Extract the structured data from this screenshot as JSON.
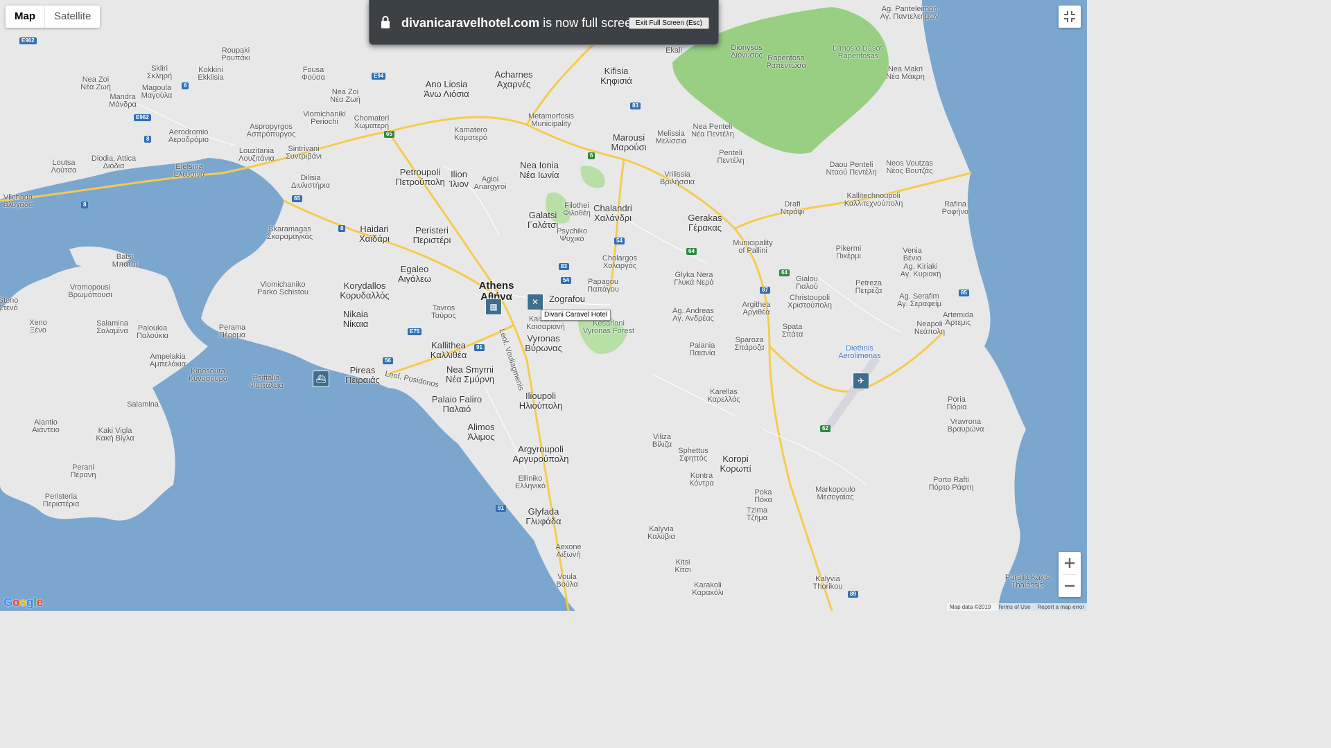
{
  "map_type": {
    "map_label": "Map",
    "satellite_label": "Satellite",
    "selected": "Map"
  },
  "fullscreen_banner": {
    "domain": "divanicaravelhotel.com",
    "message": " is now full screen",
    "exit_button": "Exit Full Screen (Esc)"
  },
  "tooltip": "Divani Caravel Hotel",
  "attribution": {
    "map_data": "Map data ©2019",
    "terms": "Terms of Use",
    "report": "Report a map error"
  },
  "logo": "Google",
  "colors": {
    "water": "#7ba7cf",
    "land": "#e8e8e8",
    "park": "#b7dfa6",
    "forest": "#98cf83",
    "highway": "#f4cb4d",
    "poi": "#3f6d8c"
  },
  "places": [
    {
      "id": "roupaki",
      "l1": "Roupaki",
      "l2": "Ρουπάκι",
      "cls": ""
    },
    {
      "id": "skliri",
      "l1": "Skliri",
      "l2": "Σκληρή",
      "cls": ""
    },
    {
      "id": "neazoi-w",
      "l1": "Nea Zoi",
      "l2": "Νέα Ζωή",
      "cls": ""
    },
    {
      "id": "magoula",
      "l1": "Magoula",
      "l2": "Μαγούλα",
      "cls": ""
    },
    {
      "id": "mandra",
      "l1": "Mandra",
      "l2": "Μάνδρα",
      "cls": ""
    },
    {
      "id": "kokkini",
      "l1": "Kokkini",
      "l2": "Ekklisia",
      "cls": ""
    },
    {
      "id": "fousa",
      "l1": "Fousa",
      "l2": "Φούσα",
      "cls": ""
    },
    {
      "id": "neazoi-e",
      "l1": "Nea Zoi",
      "l2": "Νέα Ζωή",
      "cls": ""
    },
    {
      "id": "viomichaniki",
      "l1": "Viomichaniki",
      "l2": "Periochi",
      "cls": ""
    },
    {
      "id": "chomateri",
      "l1": "Chomateri",
      "l2": "Χωματερή",
      "cls": ""
    },
    {
      "id": "aerodromio",
      "l1": "Aerodromio",
      "l2": "Αεροδρόμιο",
      "cls": ""
    },
    {
      "id": "aspropyrgos",
      "l1": "Aspropyrgos",
      "l2": "Ασπρόπυργος",
      "cls": ""
    },
    {
      "id": "sintrivani",
      "l1": "Sintrivani",
      "l2": "Συντριβάνι",
      "cls": ""
    },
    {
      "id": "loutsa",
      "l1": "Loutsa",
      "l2": "Λούτσα",
      "cls": ""
    },
    {
      "id": "diodia",
      "l1": "Diodia, Attica",
      "l2": "Διόδια",
      "cls": ""
    },
    {
      "id": "elefsina",
      "l1": "Elefsina",
      "l2": "Ελευσίνα",
      "cls": ""
    },
    {
      "id": "louzitania",
      "l1": "Louzitania",
      "l2": "Λουζιτάνια",
      "cls": ""
    },
    {
      "id": "dilisia",
      "l1": "Dilisia",
      "l2": "Διυλιστήρια",
      "cls": ""
    },
    {
      "id": "vlichada",
      "l1": "Vlichada",
      "l2": "Βλυχάδα",
      "cls": ""
    },
    {
      "id": "skaramagas",
      "l1": "Skaramagas",
      "l2": "Σκαραμαγκάς",
      "cls": ""
    },
    {
      "id": "haidari",
      "l1": "Haidari",
      "l2": "Χαϊδάρι",
      "cls": "big"
    },
    {
      "id": "acharnes",
      "l1": "Acharnes",
      "l2": "Αχαρνές",
      "cls": "big"
    },
    {
      "id": "anoliosia",
      "l1": "Ano Liosia",
      "l2": "Άνω Λιόσια",
      "cls": "big"
    },
    {
      "id": "kifisia",
      "l1": "Kifisia",
      "l2": "Κηφισιά",
      "cls": "big"
    },
    {
      "id": "kamatero",
      "l1": "Kamatero",
      "l2": "Καματερό",
      "cls": ""
    },
    {
      "id": "metamorfosis",
      "l1": "Metamorfosis",
      "l2": "Municipality",
      "cls": ""
    },
    {
      "id": "marousi",
      "l1": "Marousi",
      "l2": "Μαρούσι",
      "cls": "big"
    },
    {
      "id": "melissia",
      "l1": "Melissia",
      "l2": "Μελίσσια",
      "cls": ""
    },
    {
      "id": "neapenteli",
      "l1": "Nea Penteli",
      "l2": "Νέα Πεντέλη",
      "cls": ""
    },
    {
      "id": "penteli",
      "l1": "Penteli",
      "l2": "Πεντέλη",
      "cls": ""
    },
    {
      "id": "ekali",
      "l1": "Ekali",
      "l2": "",
      "cls": ""
    },
    {
      "id": "dionysos",
      "l1": "Dionysos",
      "l2": "Διόνυσος",
      "cls": ""
    },
    {
      "id": "rapentosa",
      "l1": "Rapentosa",
      "l2": "Ραπεντώσα",
      "cls": ""
    },
    {
      "id": "dasos",
      "l1": "Dimosio Dasos",
      "l2": "Rapentosas",
      "cls": "green"
    },
    {
      "id": "agpanteleimon",
      "l1": "Ag. Panteleimon",
      "l2": "Αγ. Παντελεήμων",
      "cls": ""
    },
    {
      "id": "neamakri",
      "l1": "Nea Makri",
      "l2": "Νέα Μάκρη",
      "cls": ""
    },
    {
      "id": "petroupoli",
      "l1": "Petroupoli",
      "l2": "Πετρούπολη",
      "cls": "big"
    },
    {
      "id": "ilion",
      "l1": "Ilion",
      "l2": "Ίλιον",
      "cls": "big"
    },
    {
      "id": "agioianargyroi",
      "l1": "Agioi",
      "l2": "Anargyroi",
      "cls": ""
    },
    {
      "id": "neaionia",
      "l1": "Nea Ionia",
      "l2": "Νέα Ιωνία",
      "cls": "big"
    },
    {
      "id": "vrilissia",
      "l1": "Vrilissia",
      "l2": "Βριλήσσια",
      "cls": ""
    },
    {
      "id": "daou",
      "l1": "Daou Penteli",
      "l2": "Νταού Πεντέλη",
      "cls": ""
    },
    {
      "id": "neosvoutzas",
      "l1": "Neos Voutzas",
      "l2": "Νέος Βουτζάς",
      "cls": ""
    },
    {
      "id": "kallitechnoupoli",
      "l1": "Kallitechnoupoli",
      "l2": "Καλλιτεχνούπολη",
      "cls": ""
    },
    {
      "id": "drafi",
      "l1": "Drafi",
      "l2": "Ντράφι",
      "cls": ""
    },
    {
      "id": "rafina",
      "l1": "Rafina",
      "l2": "Ραφήνα",
      "cls": ""
    },
    {
      "id": "galatsi",
      "l1": "Galatsi",
      "l2": "Γαλάτσι",
      "cls": "big"
    },
    {
      "id": "filothei",
      "l1": "Filothei",
      "l2": "Φιλοθέη",
      "cls": ""
    },
    {
      "id": "chalandri",
      "l1": "Chalandri",
      "l2": "Χαλάνδρι",
      "cls": "big"
    },
    {
      "id": "gerakas",
      "l1": "Gerakas",
      "l2": "Γέρακας",
      "cls": "big"
    },
    {
      "id": "peristeri",
      "l1": "Peristeri",
      "l2": "Περιστέρι",
      "cls": "big"
    },
    {
      "id": "psychiko",
      "l1": "Psychiko",
      "l2": "Ψυχικό",
      "cls": ""
    },
    {
      "id": "pallini",
      "l1": "Municipality",
      "l2": "of Pallini",
      "cls": ""
    },
    {
      "id": "pikermi",
      "l1": "Pikermi",
      "l2": "Πικέρμι",
      "cls": ""
    },
    {
      "id": "venia",
      "l1": "Venia",
      "l2": "Βένια",
      "cls": ""
    },
    {
      "id": "batsi",
      "l1": "Batsi",
      "l2": "Μπατσί",
      "cls": ""
    },
    {
      "id": "egaleo",
      "l1": "Egaleo",
      "l2": "Αιγάλεω",
      "cls": "big"
    },
    {
      "id": "cholargos",
      "l1": "Cholargos",
      "l2": "Χολαργός",
      "cls": ""
    },
    {
      "id": "agkiriaki",
      "l1": "Ag. Kiriaki",
      "l2": "Αγ. Κυριακή",
      "cls": ""
    },
    {
      "id": "vromopousi",
      "l1": "Vromopousi",
      "l2": "Βρωμόπουσι",
      "cls": ""
    },
    {
      "id": "viomichaniko",
      "l1": "Viomichaniko",
      "l2": "Parko Schistou",
      "cls": ""
    },
    {
      "id": "korydallos",
      "l1": "Korydallos",
      "l2": "Κορυδαλλός",
      "cls": "big"
    },
    {
      "id": "athens",
      "l1": "Athens",
      "l2": "Αθήνα",
      "cls": "major"
    },
    {
      "id": "papagou",
      "l1": "Papagou",
      "l2": "Παπάγου",
      "cls": ""
    },
    {
      "id": "glykanera",
      "l1": "Glyka Nera",
      "l2": "Γλυκά Νερά",
      "cls": ""
    },
    {
      "id": "gialou",
      "l1": "Gialou",
      "l2": "Γιαλού",
      "cls": ""
    },
    {
      "id": "petreza",
      "l1": "Petreza",
      "l2": "Πετρέζα",
      "cls": ""
    },
    {
      "id": "agserafim",
      "l1": "Ag. Serafim",
      "l2": "Αγ. Σεραφείμ",
      "cls": ""
    },
    {
      "id": "steno",
      "l1": "Steno",
      "l2": "Στενό",
      "cls": ""
    },
    {
      "id": "zografou",
      "l1": "Zografou",
      "l2": "",
      "cls": "big"
    },
    {
      "id": "christoupoli",
      "l1": "Christoupoli",
      "l2": "Χριστούπολη",
      "cls": ""
    },
    {
      "id": "argithea",
      "l1": "Argithea",
      "l2": "Αργιθέα",
      "cls": ""
    },
    {
      "id": "agandreas",
      "l1": "Ag. Andreas",
      "l2": "Αγ. Ανδρέας",
      "cls": ""
    },
    {
      "id": "tavros",
      "l1": "Tavros",
      "l2": "Ταύρος",
      "cls": ""
    },
    {
      "id": "nikaia",
      "l1": "Nikaia",
      "l2": "Νίκαια",
      "cls": "big"
    },
    {
      "id": "kaisariani",
      "l1": "Kaisariani",
      "l2": "Καισαριανή",
      "cls": ""
    },
    {
      "id": "kesariani",
      "l1": "Kesariani",
      "l2": "Vyronas Forest",
      "cls": "green"
    },
    {
      "id": "artemida",
      "l1": "Artemida",
      "l2": "Άρτεμις",
      "cls": ""
    },
    {
      "id": "xeno",
      "l1": "Xeno",
      "l2": "Ξένο",
      "cls": ""
    },
    {
      "id": "salaminaN",
      "l1": "Salamina",
      "l2": "Σαλαμίνα",
      "cls": ""
    },
    {
      "id": "paloukia",
      "l1": "Paloukia",
      "l2": "Παλούκια",
      "cls": ""
    },
    {
      "id": "perama",
      "l1": "Perama",
      "l2": "Πέραμα",
      "cls": ""
    },
    {
      "id": "vyronas",
      "l1": "Vyronas",
      "l2": "Βύρωνας",
      "cls": "big"
    },
    {
      "id": "kallithea",
      "l1": "Kallithea",
      "l2": "Καλλιθέα",
      "cls": "big"
    },
    {
      "id": "paiania",
      "l1": "Paiania",
      "l2": "Παιανία",
      "cls": ""
    },
    {
      "id": "spata",
      "l1": "Spata",
      "l2": "Σπάτα",
      "cls": ""
    },
    {
      "id": "neapoli",
      "l1": "Neapoli",
      "l2": "Νεάπολη",
      "cls": ""
    },
    {
      "id": "sparoza",
      "l1": "Sparoza",
      "l2": "Σπάροζα",
      "cls": ""
    },
    {
      "id": "airport",
      "l1": "Diethnis",
      "l2": "Aerolimenas",
      "cls": "blue"
    },
    {
      "id": "ampelakia",
      "l1": "Ampelakia",
      "l2": "Αμπελάκια",
      "cls": ""
    },
    {
      "id": "kinosoura",
      "l1": "Kinosoura",
      "l2": "Κυνόσουρα",
      "cls": ""
    },
    {
      "id": "psittalia",
      "l1": "Psittalia",
      "l2": "Ψυττάλεια",
      "cls": ""
    },
    {
      "id": "pireas",
      "l1": "Pireas",
      "l2": "Πειραιάς",
      "cls": "big"
    },
    {
      "id": "neasmyrni",
      "l1": "Nea Smyrni",
      "l2": "Νέα Σμύρνη",
      "cls": "big"
    },
    {
      "id": "paleofaliro",
      "l1": "Palaio Faliro",
      "l2": "Παλαιό",
      "cls": "big"
    },
    {
      "id": "ilioupoli",
      "l1": "Ilioupoli",
      "l2": "Ηλιούπολη",
      "cls": "big"
    },
    {
      "id": "karellas",
      "l1": "Karellas",
      "l2": "Καρελλάς",
      "cls": ""
    },
    {
      "id": "salamina",
      "l1": "Salamina",
      "l2": "",
      "cls": ""
    },
    {
      "id": "poria",
      "l1": "Poria",
      "l2": "Πόρια",
      "cls": ""
    },
    {
      "id": "vravrona",
      "l1": "Vravrona",
      "l2": "Βραυρώνα",
      "cls": ""
    },
    {
      "id": "aiantio",
      "l1": "Aiantio",
      "l2": "Αιάντειο",
      "cls": ""
    },
    {
      "id": "alimos",
      "l1": "Alimos",
      "l2": "Άλιμος",
      "cls": "big"
    },
    {
      "id": "kakivigla",
      "l1": "Kaki Vigla",
      "l2": "Κακή Βίγλα",
      "cls": ""
    },
    {
      "id": "viliza",
      "l1": "Viliza",
      "l2": "Βίλιζα",
      "cls": ""
    },
    {
      "id": "sphettus",
      "l1": "Sphettus",
      "l2": "Σφηττός",
      "cls": ""
    },
    {
      "id": "koropi",
      "l1": "Koropi",
      "l2": "Κορωπί",
      "cls": "big"
    },
    {
      "id": "argyroupoli",
      "l1": "Argyroupoli",
      "l2": "Αργυρούπολη",
      "cls": "big"
    },
    {
      "id": "perani",
      "l1": "Perani",
      "l2": "Πέρανη",
      "cls": ""
    },
    {
      "id": "kontra",
      "l1": "Kontra",
      "l2": "Κόντρα",
      "cls": ""
    },
    {
      "id": "ellinikio",
      "l1": "Elliniko",
      "l2": "Ελληνικό",
      "cls": ""
    },
    {
      "id": "portorafti",
      "l1": "Porto Rafti",
      "l2": "Πόρτο Ράφτη",
      "cls": ""
    },
    {
      "id": "markopoulo",
      "l1": "Markopoulo",
      "l2": "Μεσογαίας",
      "cls": ""
    },
    {
      "id": "peristeria",
      "l1": "Peristeria",
      "l2": "Περιστέρια",
      "cls": ""
    },
    {
      "id": "poka",
      "l1": "Poka",
      "l2": "Πόκα",
      "cls": ""
    },
    {
      "id": "tzima",
      "l1": "Tzima",
      "l2": "Τζήμα",
      "cls": ""
    },
    {
      "id": "glyfada",
      "l1": "Glyfada",
      "l2": "Γλυφάδα",
      "cls": "big"
    },
    {
      "id": "kalyvia",
      "l1": "Kalyvia",
      "l2": "Καλύβια",
      "cls": ""
    },
    {
      "id": "aixoni",
      "l1": "Aexone",
      "l2": "Αιξωνή",
      "cls": ""
    },
    {
      "id": "kitsi",
      "l1": "Kitsi",
      "l2": "Κίτσι",
      "cls": ""
    },
    {
      "id": "voula",
      "l1": "Voula",
      "l2": "Βούλα",
      "cls": ""
    },
    {
      "id": "karakoli",
      "l1": "Karakoli",
      "l2": "Καρακόλι",
      "cls": ""
    },
    {
      "id": "kalyviathorikou",
      "l1": "Kalyvia",
      "l2": "Thorikou",
      "cls": ""
    },
    {
      "id": "paralia",
      "l1": "Paralia Kakis",
      "l2": "Thalassis",
      "cls": ""
    },
    {
      "id": "leofposidonos",
      "l1": "Leof. Posidonos",
      "l2": "",
      "cls": ""
    },
    {
      "id": "leofvouliagmenis",
      "l1": "Leof. Vouliagmenis",
      "l2": "",
      "cls": ""
    }
  ],
  "shields": [
    {
      "id": "e962a",
      "t": "E962"
    },
    {
      "id": "e962b",
      "t": "E962"
    },
    {
      "id": "e94",
      "t": "E94"
    },
    {
      "id": "r8a",
      "t": "8"
    },
    {
      "id": "r8b",
      "t": "8"
    },
    {
      "id": "r8c",
      "t": "8"
    },
    {
      "id": "r6a",
      "t": "6"
    },
    {
      "id": "r6b",
      "t": "6"
    },
    {
      "id": "r65a",
      "t": "65"
    },
    {
      "id": "r65b",
      "t": "65"
    },
    {
      "id": "r83a",
      "t": "83"
    },
    {
      "id": "r83b",
      "t": "83"
    },
    {
      "id": "r54a",
      "t": "54"
    },
    {
      "id": "r54b",
      "t": "54"
    },
    {
      "id": "r64a",
      "t": "64"
    },
    {
      "id": "r64b",
      "t": "64"
    },
    {
      "id": "r85",
      "t": "85"
    },
    {
      "id": "r91a",
      "t": "91"
    },
    {
      "id": "r91b",
      "t": "91"
    },
    {
      "id": "r56",
      "t": "56"
    },
    {
      "id": "e75",
      "t": "E75"
    },
    {
      "id": "r62",
      "t": "62"
    },
    {
      "id": "r87",
      "t": "87"
    },
    {
      "id": "r89",
      "t": "89"
    }
  ]
}
